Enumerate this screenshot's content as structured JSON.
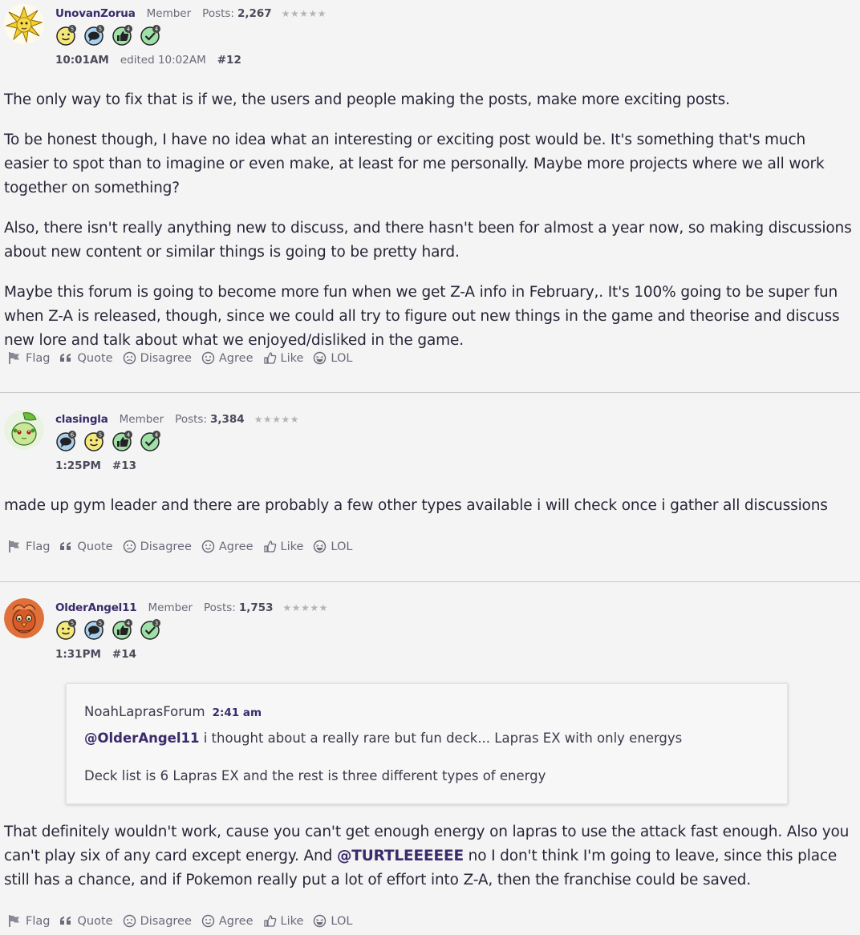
{
  "actions": {
    "flag": "Flag",
    "quote": "Quote",
    "disagree": "Disagree",
    "agree": "Agree",
    "like": "Like",
    "lol": "LOL"
  },
  "posts": [
    {
      "username": "UnovanZorua",
      "role": "Member",
      "posts_label": "Posts:",
      "posts_count": "2,267",
      "stars": "★★★★★",
      "time": "10:01AM",
      "edited": "edited 10:02AM",
      "number": "#12",
      "avatar_icon": "jolteon-avatar-icon",
      "badges": [
        {
          "icon": "smiley-badge-icon",
          "level": "5"
        },
        {
          "icon": "comment-badge-icon",
          "level": "5"
        },
        {
          "icon": "thumbs-up-badge-icon",
          "level": "4"
        },
        {
          "icon": "check-badge-icon",
          "level": "4"
        }
      ],
      "paragraphs": [
        "The only way to fix that is if we, the users and people making the posts, make more exciting posts.",
        "To be honest though, I have no idea what an interesting or exciting post would be. It's something that's much easier to spot than to imagine or even make, at least for me personally. Maybe more projects where we all work together on something?",
        "Also, there isn't really anything new to discuss, and there hasn't been for almost a year now, so making discussions about new content or similar things is going to be pretty hard.",
        "Maybe this forum is going to become more fun when we get Z-A info in February,. It's 100% going to be super fun when Z-A is released, though, since we could all try to figure out new things in the game and theorise and discuss new lore and talk about what we enjoyed/disliked in the game."
      ]
    },
    {
      "username": "clasingla",
      "role": "Member",
      "posts_label": "Posts:",
      "posts_count": "3,384",
      "stars": "★★★★★",
      "time": "1:25PM",
      "number": "#13",
      "avatar_icon": "chikorita-avatar-icon",
      "badges": [
        {
          "icon": "comment-badge-icon",
          "level": "6"
        },
        {
          "icon": "smiley-badge-icon",
          "level": "5"
        },
        {
          "icon": "thumbs-up-badge-icon",
          "level": "4"
        },
        {
          "icon": "check-badge-icon",
          "level": "4"
        }
      ],
      "paragraphs": [
        "made up gym leader and there are probably a few other types available i will check once i gather all discussions"
      ]
    },
    {
      "username": "OlderAngel11",
      "role": "Member",
      "posts_label": "Posts:",
      "posts_count": "1,753",
      "stars": "★★★★★",
      "time": "1:31PM",
      "number": "#14",
      "avatar_icon": "fletchinder-avatar-icon",
      "badges": [
        {
          "icon": "smiley-badge-icon",
          "level": "5"
        },
        {
          "icon": "comment-badge-icon",
          "level": "5"
        },
        {
          "icon": "thumbs-up-badge-icon",
          "level": "4"
        },
        {
          "icon": "check-badge-icon",
          "level": "3"
        }
      ],
      "quote": {
        "author": "NoahLaprasForum",
        "time": "2:41 am",
        "mention": "@OlderAngel11",
        "line1_rest": " i thought about a really rare but fun deck... Lapras EX with only energys",
        "line2": "Deck list is 6 Lapras EX and the rest is three different types of energy"
      },
      "body_part1": "That definitely wouldn't work, cause you can't get enough energy on lapras to use the attack fast enough. Also you can't play six of any card except energy. And ",
      "body_mention": "@TURTLEEEEEE",
      "body_part2": " no I don't think I'm going to leave, since this place still has a chance, and if Pokemon really put a lot of effort into Z-A, then the franchise could be saved."
    }
  ],
  "colors": {
    "background": "#f4f4f4",
    "username": "#3a2b6a",
    "text": "#262638",
    "muted": "#6a6a7a",
    "badge_yellow": "#f4e87a",
    "badge_blue": "#a8d0f0",
    "badge_green": "#9fe0a8"
  }
}
